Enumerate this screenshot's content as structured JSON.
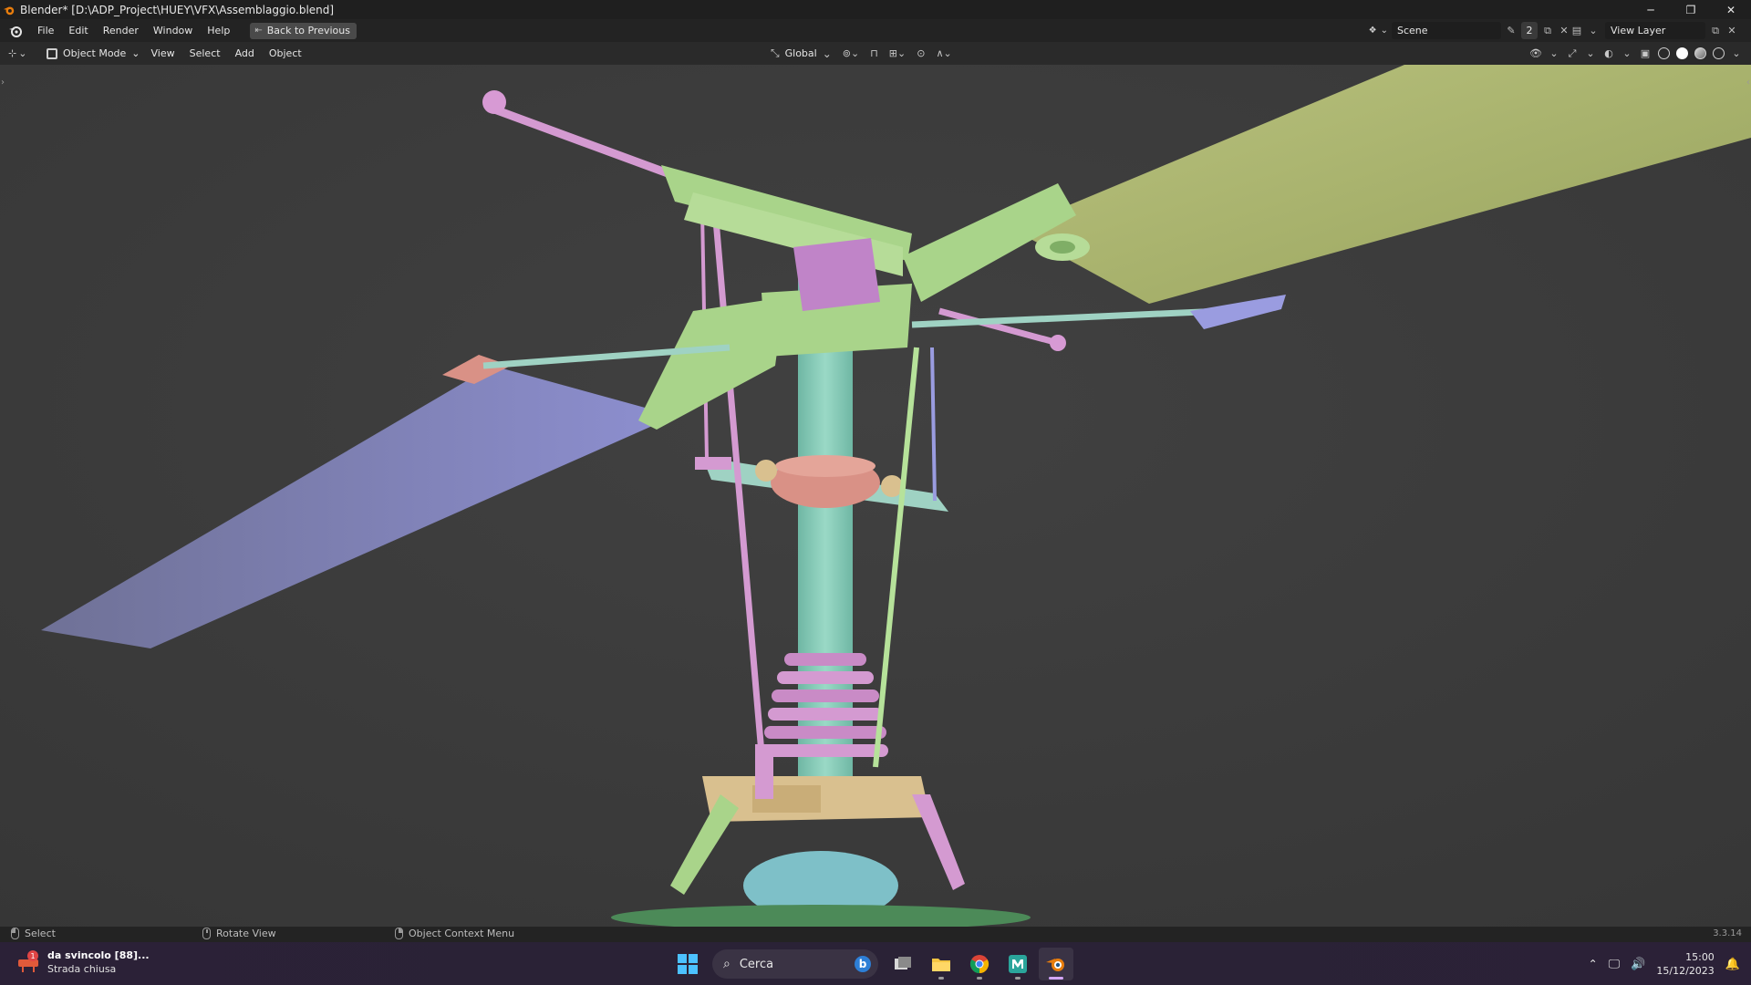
{
  "window": {
    "title": "Blender* [D:\\ADP_Project\\HUEY\\VFX\\Assemblaggio.blend]",
    "controls": {
      "minimize": "─",
      "maximize": "❐",
      "close": "✕"
    }
  },
  "topbar": {
    "menus": [
      "File",
      "Edit",
      "Render",
      "Window",
      "Help"
    ],
    "back_button": "Back to Previous",
    "scene_name": "Scene",
    "scene_users": "2",
    "view_layer": "View Layer"
  },
  "viewport_header": {
    "mode": "Object Mode",
    "menus": [
      "View",
      "Select",
      "Add",
      "Object"
    ],
    "transform_orientation": "Global"
  },
  "statusbar": {
    "select": "Select",
    "rotate": "Rotate View",
    "context": "Object Context Menu",
    "version": "3.3.14"
  },
  "taskbar": {
    "news_title": "da svincolo [88]...",
    "news_subtitle": "Strada chiusa",
    "news_badge": "1",
    "search_label": "Cerca",
    "time": "15:00",
    "date": "15/12/2023"
  },
  "colors": {
    "viewport_bg": "#3d3d3d",
    "rotor_green": "#a9d48a",
    "mast_teal": "#86cbb8",
    "pink": "#d79ad4",
    "salmon": "#d99186",
    "blade_olive": "#a9b56e",
    "blade_blue": "#8a8cc8",
    "tan": "#d9c08f"
  }
}
